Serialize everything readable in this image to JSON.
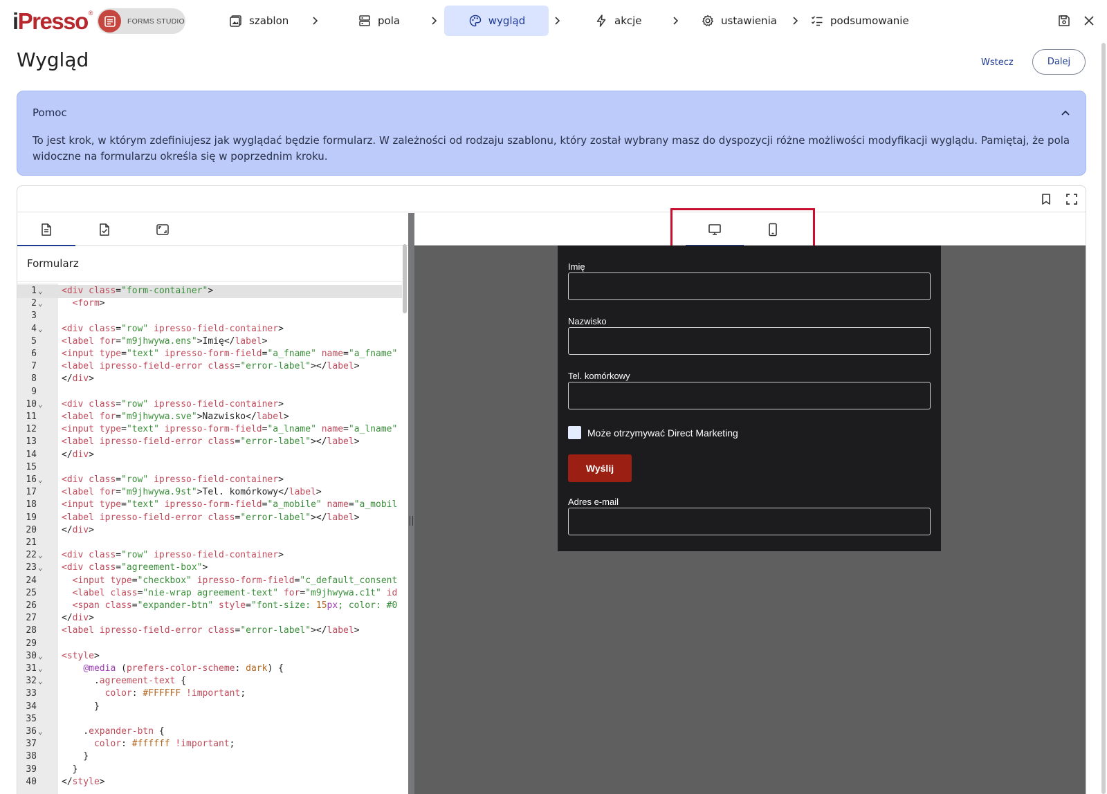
{
  "app": {
    "logo_prefix": "i",
    "logo_text": "Presso",
    "studio_label": "FORMS STUDIO"
  },
  "steps": [
    {
      "label": "szablon",
      "icon": "template-icon"
    },
    {
      "label": "pola",
      "icon": "fields-icon"
    },
    {
      "label": "wygląd",
      "icon": "palette-icon",
      "active": true
    },
    {
      "label": "akcje",
      "icon": "lightning-icon"
    },
    {
      "label": "ustawienia",
      "icon": "gear-icon"
    },
    {
      "label": "podsumowanie",
      "icon": "checklist-icon"
    }
  ],
  "page": {
    "title": "Wygląd",
    "back_label": "Wstecz",
    "next_label": "Dalej"
  },
  "help": {
    "title": "Pomoc",
    "text": "To jest krok, w którym zdefiniujesz jak wyglądać będzie formularz. W zależności od rodzaju szablonu, który został wybrany masz do dyspozycji różne możliwości modyfikacji wyglądu. Pamiętaj, że pola widoczne na formularzu określa się w poprzednim kroku."
  },
  "editor": {
    "section_label": "Formularz",
    "left_tabs": [
      "html-file-icon",
      "validated-file-icon",
      "resize-icon"
    ],
    "active_left_tab": 0,
    "right_tabs": [
      "desktop-icon",
      "mobile-icon"
    ],
    "active_right_tab": 0,
    "code_lines": [
      {
        "n": "1",
        "fold": true,
        "cur": true,
        "segs": [
          [
            "#c04a5a",
            "<div "
          ],
          [
            "#c04a5a",
            "class"
          ],
          [
            "#1f1f1f",
            "="
          ],
          [
            "#3a8f3a",
            "\"form-container\""
          ],
          [
            "#1f1f1f",
            ">"
          ]
        ]
      },
      {
        "n": "2",
        "fold": true,
        "segs": [
          [
            "#1f1f1f",
            "  "
          ],
          [
            "#c04a5a",
            "<form"
          ],
          [
            "#1f1f1f",
            ">"
          ]
        ]
      },
      {
        "n": "3",
        "segs": []
      },
      {
        "n": "4",
        "fold": true,
        "segs": [
          [
            "#c04a5a",
            "<div "
          ],
          [
            "#c04a5a",
            "class"
          ],
          [
            "#1f1f1f",
            "="
          ],
          [
            "#3a8f3a",
            "\"row\""
          ],
          [
            "#c04a5a",
            " ipresso-field-container"
          ],
          [
            "#1f1f1f",
            ">"
          ]
        ]
      },
      {
        "n": "5",
        "segs": [
          [
            "#c04a5a",
            "<label "
          ],
          [
            "#c04a5a",
            "for"
          ],
          [
            "#1f1f1f",
            "="
          ],
          [
            "#3a8f3a",
            "\"m9jhwywa.ens\""
          ],
          [
            "#1f1f1f",
            ">Imię</"
          ],
          [
            "#c04a5a",
            "label"
          ],
          [
            "#1f1f1f",
            ">"
          ]
        ]
      },
      {
        "n": "6",
        "segs": [
          [
            "#c04a5a",
            "<input "
          ],
          [
            "#c04a5a",
            "type"
          ],
          [
            "#1f1f1f",
            "="
          ],
          [
            "#3a8f3a",
            "\"text\""
          ],
          [
            "#c04a5a",
            " ipresso-form-field"
          ],
          [
            "#1f1f1f",
            "="
          ],
          [
            "#3a8f3a",
            "\"a_fname\""
          ],
          [
            "#c04a5a",
            " name"
          ],
          [
            "#1f1f1f",
            "="
          ],
          [
            "#3a8f3a",
            "\"a_fname\""
          ]
        ]
      },
      {
        "n": "7",
        "segs": [
          [
            "#c04a5a",
            "<label "
          ],
          [
            "#c04a5a",
            "ipresso-field-error "
          ],
          [
            "#c04a5a",
            "class"
          ],
          [
            "#1f1f1f",
            "="
          ],
          [
            "#3a8f3a",
            "\"error-label\""
          ],
          [
            "#1f1f1f",
            "></"
          ],
          [
            "#c04a5a",
            "label"
          ],
          [
            "#1f1f1f",
            ">"
          ]
        ]
      },
      {
        "n": "8",
        "segs": [
          [
            "#1f1f1f",
            "</"
          ],
          [
            "#c04a5a",
            "div"
          ],
          [
            "#1f1f1f",
            ">"
          ]
        ]
      },
      {
        "n": "9",
        "segs": []
      },
      {
        "n": "10",
        "fold": true,
        "segs": [
          [
            "#c04a5a",
            "<div "
          ],
          [
            "#c04a5a",
            "class"
          ],
          [
            "#1f1f1f",
            "="
          ],
          [
            "#3a8f3a",
            "\"row\""
          ],
          [
            "#c04a5a",
            " ipresso-field-container"
          ],
          [
            "#1f1f1f",
            ">"
          ]
        ]
      },
      {
        "n": "11",
        "segs": [
          [
            "#c04a5a",
            "<label "
          ],
          [
            "#c04a5a",
            "for"
          ],
          [
            "#1f1f1f",
            "="
          ],
          [
            "#3a8f3a",
            "\"m9jhwywa.sve\""
          ],
          [
            "#1f1f1f",
            ">Nazwisko</"
          ],
          [
            "#c04a5a",
            "label"
          ],
          [
            "#1f1f1f",
            ">"
          ]
        ]
      },
      {
        "n": "12",
        "segs": [
          [
            "#c04a5a",
            "<input "
          ],
          [
            "#c04a5a",
            "type"
          ],
          [
            "#1f1f1f",
            "="
          ],
          [
            "#3a8f3a",
            "\"text\""
          ],
          [
            "#c04a5a",
            " ipresso-form-field"
          ],
          [
            "#1f1f1f",
            "="
          ],
          [
            "#3a8f3a",
            "\"a_lname\""
          ],
          [
            "#c04a5a",
            " name"
          ],
          [
            "#1f1f1f",
            "="
          ],
          [
            "#3a8f3a",
            "\"a_lname\""
          ]
        ]
      },
      {
        "n": "13",
        "segs": [
          [
            "#c04a5a",
            "<label "
          ],
          [
            "#c04a5a",
            "ipresso-field-error "
          ],
          [
            "#c04a5a",
            "class"
          ],
          [
            "#1f1f1f",
            "="
          ],
          [
            "#3a8f3a",
            "\"error-label\""
          ],
          [
            "#1f1f1f",
            "></"
          ],
          [
            "#c04a5a",
            "label"
          ],
          [
            "#1f1f1f",
            ">"
          ]
        ]
      },
      {
        "n": "14",
        "segs": [
          [
            "#1f1f1f",
            "</"
          ],
          [
            "#c04a5a",
            "div"
          ],
          [
            "#1f1f1f",
            ">"
          ]
        ]
      },
      {
        "n": "15",
        "segs": []
      },
      {
        "n": "16",
        "fold": true,
        "segs": [
          [
            "#c04a5a",
            "<div "
          ],
          [
            "#c04a5a",
            "class"
          ],
          [
            "#1f1f1f",
            "="
          ],
          [
            "#3a8f3a",
            "\"row\""
          ],
          [
            "#c04a5a",
            " ipresso-field-container"
          ],
          [
            "#1f1f1f",
            ">"
          ]
        ]
      },
      {
        "n": "17",
        "segs": [
          [
            "#c04a5a",
            "<label "
          ],
          [
            "#c04a5a",
            "for"
          ],
          [
            "#1f1f1f",
            "="
          ],
          [
            "#3a8f3a",
            "\"m9jhwywa.9st\""
          ],
          [
            "#1f1f1f",
            ">Tel. komórkowy</"
          ],
          [
            "#c04a5a",
            "label"
          ],
          [
            "#1f1f1f",
            ">"
          ]
        ]
      },
      {
        "n": "18",
        "segs": [
          [
            "#c04a5a",
            "<input "
          ],
          [
            "#c04a5a",
            "type"
          ],
          [
            "#1f1f1f",
            "="
          ],
          [
            "#3a8f3a",
            "\"text\""
          ],
          [
            "#c04a5a",
            " ipresso-form-field"
          ],
          [
            "#1f1f1f",
            "="
          ],
          [
            "#3a8f3a",
            "\"a_mobile\""
          ],
          [
            "#c04a5a",
            " name"
          ],
          [
            "#1f1f1f",
            "="
          ],
          [
            "#3a8f3a",
            "\"a_mobil"
          ]
        ]
      },
      {
        "n": "19",
        "segs": [
          [
            "#c04a5a",
            "<label "
          ],
          [
            "#c04a5a",
            "ipresso-field-error "
          ],
          [
            "#c04a5a",
            "class"
          ],
          [
            "#1f1f1f",
            "="
          ],
          [
            "#3a8f3a",
            "\"error-label\""
          ],
          [
            "#1f1f1f",
            "></"
          ],
          [
            "#c04a5a",
            "label"
          ],
          [
            "#1f1f1f",
            ">"
          ]
        ]
      },
      {
        "n": "20",
        "segs": [
          [
            "#1f1f1f",
            "</"
          ],
          [
            "#c04a5a",
            "div"
          ],
          [
            "#1f1f1f",
            ">"
          ]
        ]
      },
      {
        "n": "21",
        "segs": []
      },
      {
        "n": "22",
        "fold": true,
        "segs": [
          [
            "#c04a5a",
            "<div "
          ],
          [
            "#c04a5a",
            "class"
          ],
          [
            "#1f1f1f",
            "="
          ],
          [
            "#3a8f3a",
            "\"row\""
          ],
          [
            "#c04a5a",
            " ipresso-field-container"
          ],
          [
            "#1f1f1f",
            ">"
          ]
        ]
      },
      {
        "n": "23",
        "fold": true,
        "segs": [
          [
            "#c04a5a",
            "<div "
          ],
          [
            "#c04a5a",
            "class"
          ],
          [
            "#1f1f1f",
            "="
          ],
          [
            "#3a8f3a",
            "\"agreement-box\""
          ],
          [
            "#1f1f1f",
            ">"
          ]
        ]
      },
      {
        "n": "24",
        "segs": [
          [
            "#1f1f1f",
            "  "
          ],
          [
            "#c04a5a",
            "<input "
          ],
          [
            "#c04a5a",
            "type"
          ],
          [
            "#1f1f1f",
            "="
          ],
          [
            "#3a8f3a",
            "\"checkbox\""
          ],
          [
            "#c04a5a",
            " ipresso-form-field"
          ],
          [
            "#1f1f1f",
            "="
          ],
          [
            "#3a8f3a",
            "\"c_default_consent"
          ]
        ]
      },
      {
        "n": "25",
        "segs": [
          [
            "#1f1f1f",
            "  "
          ],
          [
            "#c04a5a",
            "<label "
          ],
          [
            "#c04a5a",
            "class"
          ],
          [
            "#1f1f1f",
            "="
          ],
          [
            "#3a8f3a",
            "\"nie-wrap agreement-text\""
          ],
          [
            "#c04a5a",
            " for"
          ],
          [
            "#1f1f1f",
            "="
          ],
          [
            "#3a8f3a",
            "\"m9jhwywa.c1t\""
          ],
          [
            "#c04a5a",
            " id"
          ]
        ]
      },
      {
        "n": "26",
        "segs": [
          [
            "#1f1f1f",
            "  "
          ],
          [
            "#c04a5a",
            "<span "
          ],
          [
            "#c04a5a",
            "class"
          ],
          [
            "#1f1f1f",
            "="
          ],
          [
            "#3a8f3a",
            "\"expander-btn\""
          ],
          [
            "#c04a5a",
            " style"
          ],
          [
            "#1f1f1f",
            "="
          ],
          [
            "#3a8f3a",
            "\"font-size: "
          ],
          [
            "#b5651d",
            "15"
          ],
          [
            "#9b3bb5",
            "px"
          ],
          [
            "#3a8f3a",
            "; color: #0"
          ]
        ]
      },
      {
        "n": "27",
        "segs": [
          [
            "#1f1f1f",
            "</"
          ],
          [
            "#c04a5a",
            "div"
          ],
          [
            "#1f1f1f",
            ">"
          ]
        ]
      },
      {
        "n": "28",
        "segs": [
          [
            "#c04a5a",
            "<label "
          ],
          [
            "#c04a5a",
            "ipresso-field-error "
          ],
          [
            "#c04a5a",
            "class"
          ],
          [
            "#1f1f1f",
            "="
          ],
          [
            "#3a8f3a",
            "\"error-label\""
          ],
          [
            "#1f1f1f",
            "></"
          ],
          [
            "#c04a5a",
            "label"
          ],
          [
            "#1f1f1f",
            ">"
          ]
        ]
      },
      {
        "n": "29",
        "segs": []
      },
      {
        "n": "30",
        "fold": true,
        "segs": [
          [
            "#c04a5a",
            "<style"
          ],
          [
            "#1f1f1f",
            ">"
          ]
        ]
      },
      {
        "n": "31",
        "fold": true,
        "segs": [
          [
            "#1f1f1f",
            "    "
          ],
          [
            "#9b3bb5",
            "@media"
          ],
          [
            "#1f1f1f",
            " ("
          ],
          [
            "#c04a5a",
            "prefers-color-scheme"
          ],
          [
            "#1f1f1f",
            ": "
          ],
          [
            "#b5651d",
            "dark"
          ],
          [
            "#1f1f1f",
            ") {"
          ]
        ]
      },
      {
        "n": "32",
        "fold": true,
        "segs": [
          [
            "#1f1f1f",
            "      ."
          ],
          [
            "#c04a5a",
            "agreement-text"
          ],
          [
            "#1f1f1f",
            " {"
          ]
        ]
      },
      {
        "n": "33",
        "segs": [
          [
            "#1f1f1f",
            "        "
          ],
          [
            "#c04a5a",
            "color"
          ],
          [
            "#1f1f1f",
            ": "
          ],
          [
            "#b5651d",
            "#FFFFFF"
          ],
          [
            "#c04a5a",
            " !important"
          ],
          [
            "#1f1f1f",
            ";"
          ]
        ]
      },
      {
        "n": "34",
        "segs": [
          [
            "#1f1f1f",
            "      }"
          ]
        ]
      },
      {
        "n": "35",
        "segs": []
      },
      {
        "n": "36",
        "fold": true,
        "segs": [
          [
            "#1f1f1f",
            "    ."
          ],
          [
            "#c04a5a",
            "expander-btn"
          ],
          [
            "#1f1f1f",
            " {"
          ]
        ]
      },
      {
        "n": "37",
        "segs": [
          [
            "#1f1f1f",
            "      "
          ],
          [
            "#c04a5a",
            "color"
          ],
          [
            "#1f1f1f",
            ": "
          ],
          [
            "#b5651d",
            "#ffffff"
          ],
          [
            "#c04a5a",
            " !important"
          ],
          [
            "#1f1f1f",
            ";"
          ]
        ]
      },
      {
        "n": "38",
        "segs": [
          [
            "#1f1f1f",
            "    }"
          ]
        ]
      },
      {
        "n": "39",
        "segs": [
          [
            "#1f1f1f",
            "  }"
          ]
        ]
      },
      {
        "n": "40",
        "segs": [
          [
            "#1f1f1f",
            "</"
          ],
          [
            "#c04a5a",
            "style"
          ],
          [
            "#1f1f1f",
            ">"
          ]
        ]
      }
    ]
  },
  "preview": {
    "fields": [
      {
        "label": "Imię",
        "value": ""
      },
      {
        "label": "Nazwisko",
        "value": ""
      },
      {
        "label": "Tel. komórkowy",
        "value": ""
      }
    ],
    "consent_label": "Może otrzymywać Direct Marketing",
    "submit_label": "Wyślij",
    "email_label": "Adres e-mail",
    "colors": {
      "card_bg": "#1c1c1e",
      "submit_bg": "#9b1f12",
      "stage_bg": "#5f5f5f",
      "highlight": "#c8102e"
    }
  },
  "colors": {
    "accent": "#1f3a93",
    "help_bg": "#bccbf9",
    "brand_red": "#b7282e"
  }
}
